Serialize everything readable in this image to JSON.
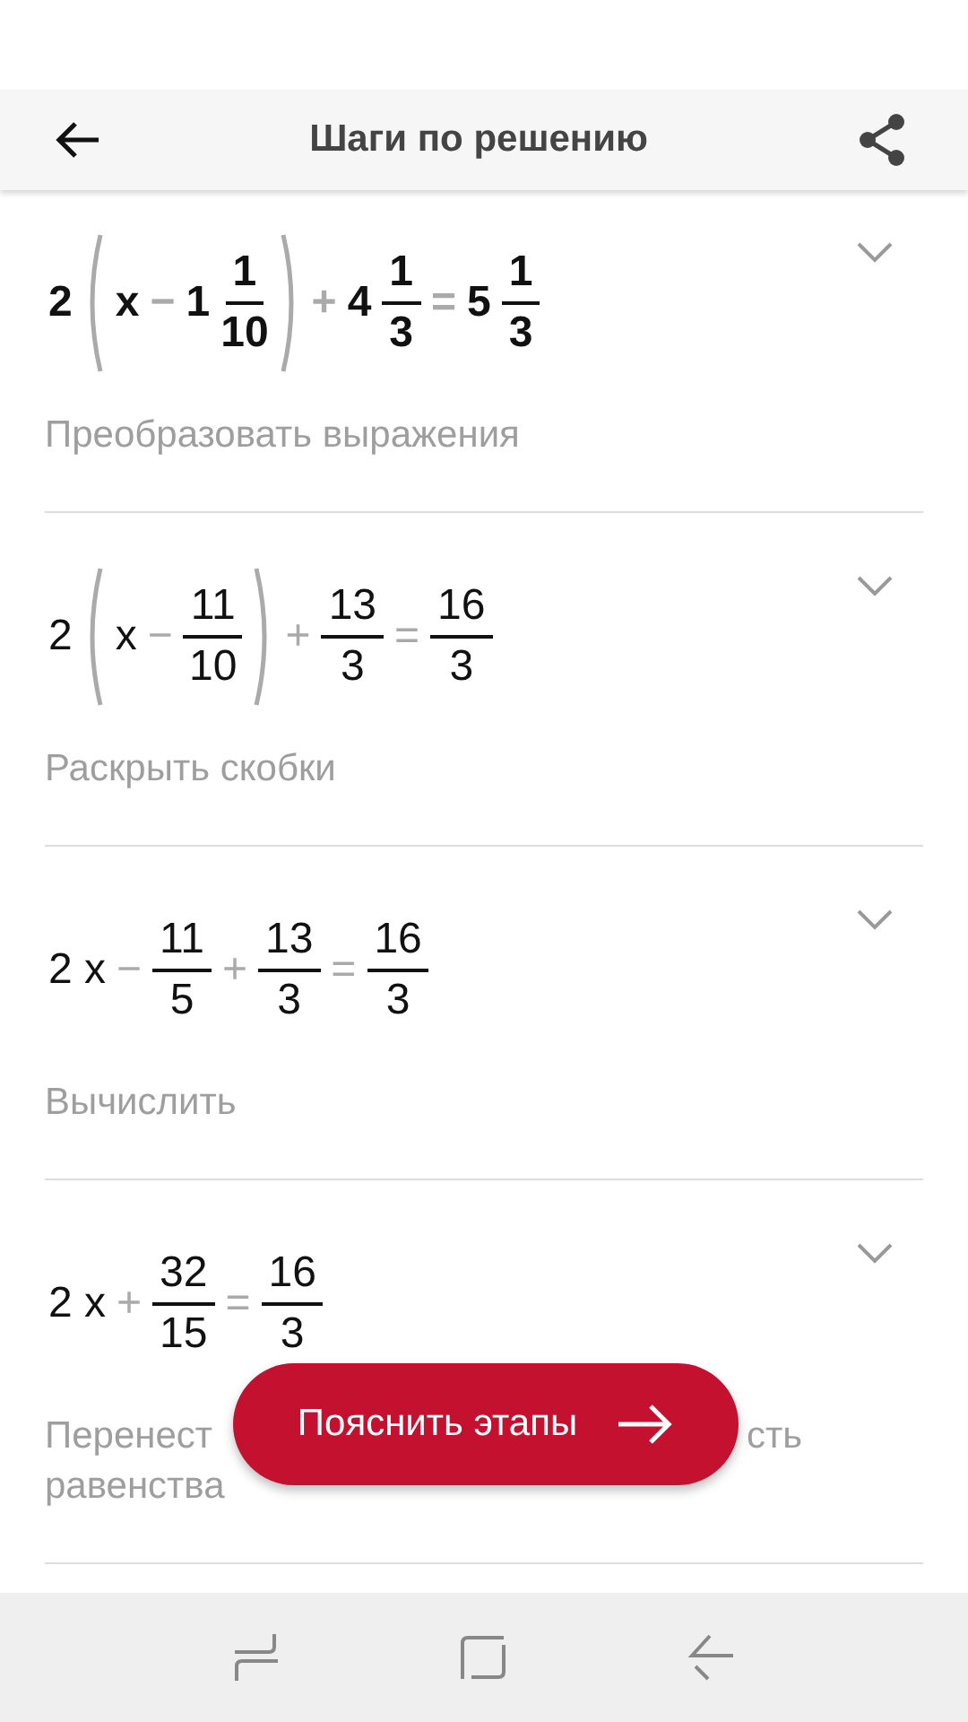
{
  "header": {
    "title": "Шаги по решению"
  },
  "steps": [
    {
      "bold": true,
      "expanded": false,
      "expression": [
        {
          "kind": "text",
          "t": "2"
        },
        {
          "kind": "group",
          "children": [
            {
              "kind": "text",
              "t": "x"
            },
            {
              "kind": "op",
              "t": "−"
            },
            {
              "kind": "text",
              "t": "1"
            },
            {
              "kind": "frac",
              "num": "1",
              "den": "10"
            }
          ]
        },
        {
          "kind": "op",
          "t": "+"
        },
        {
          "kind": "text",
          "t": "4"
        },
        {
          "kind": "frac",
          "num": "1",
          "den": "3"
        },
        {
          "kind": "op",
          "t": "="
        },
        {
          "kind": "text",
          "t": "5"
        },
        {
          "kind": "frac",
          "num": "1",
          "den": "3"
        }
      ],
      "description": [
        [
          "Преобразовать выражения"
        ]
      ]
    },
    {
      "bold": false,
      "expanded": false,
      "expression": [
        {
          "kind": "text",
          "t": "2"
        },
        {
          "kind": "group",
          "children": [
            {
              "kind": "text",
              "t": "x"
            },
            {
              "kind": "op",
              "t": "−"
            },
            {
              "kind": "frac",
              "num": "11",
              "den": "10"
            }
          ]
        },
        {
          "kind": "op",
          "t": "+"
        },
        {
          "kind": "frac",
          "num": "13",
          "den": "3"
        },
        {
          "kind": "op",
          "t": "="
        },
        {
          "kind": "frac",
          "num": "16",
          "den": "3"
        }
      ],
      "description": [
        [
          "Раскрыть скобки"
        ]
      ]
    },
    {
      "bold": false,
      "expanded": false,
      "expression": [
        {
          "kind": "text",
          "t": "2 x"
        },
        {
          "kind": "op",
          "t": "−"
        },
        {
          "kind": "frac",
          "num": "11",
          "den": "5"
        },
        {
          "kind": "op",
          "t": "+"
        },
        {
          "kind": "frac",
          "num": "13",
          "den": "3"
        },
        {
          "kind": "op",
          "t": "="
        },
        {
          "kind": "frac",
          "num": "16",
          "den": "3"
        }
      ],
      "description": [
        [
          "Вычислить"
        ]
      ]
    },
    {
      "bold": false,
      "expanded": false,
      "expression": [
        {
          "kind": "text",
          "t": "2 x"
        },
        {
          "kind": "op",
          "t": "+"
        },
        {
          "kind": "frac",
          "num": "32",
          "den": "15"
        },
        {
          "kind": "op",
          "t": "="
        },
        {
          "kind": "frac",
          "num": "16",
          "den": "3"
        }
      ],
      "description": [
        [
          "Перенест",
          "сть"
        ],
        [
          "равенства"
        ]
      ]
    }
  ],
  "explain_button": {
    "label": "Пояснить этапы"
  }
}
